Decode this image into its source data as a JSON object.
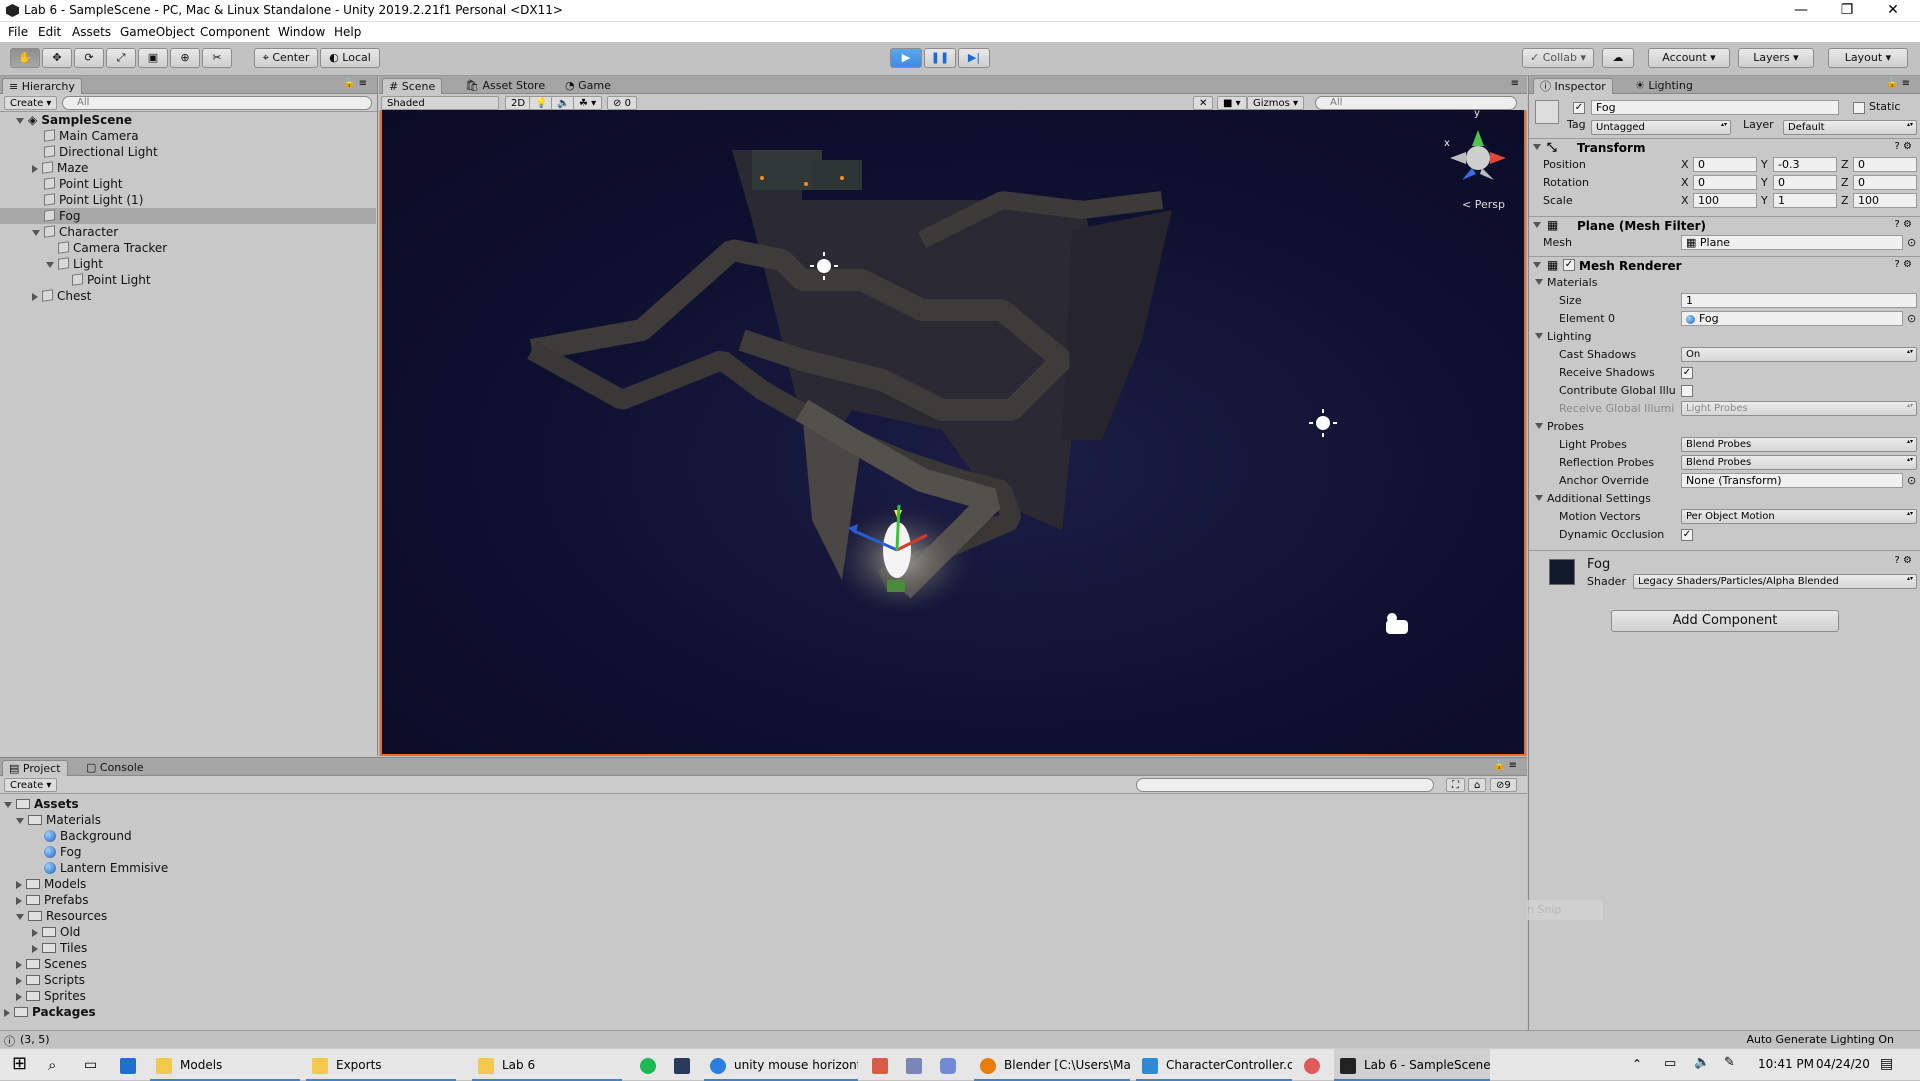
{
  "window": {
    "title": "Lab 6 - SampleScene - PC, Mac & Linux Standalone - Unity 2019.2.21f1 Personal <DX11>",
    "controls": {
      "minimize": "—",
      "maximize": "❐",
      "close": "✕"
    }
  },
  "menu": [
    "File",
    "Edit",
    "Assets",
    "GameObject",
    "Component",
    "Window",
    "Help"
  ],
  "toolbar": {
    "tools": [
      "hand-icon",
      "move-icon",
      "rotate-icon",
      "scale-icon",
      "rect-icon",
      "transform-icon",
      "custom-tool-icon"
    ],
    "pivot": "Center",
    "space": "Local",
    "play_state": "playing",
    "collab": "Collab",
    "account": "Account",
    "layers": "Layers",
    "layout": "Layout"
  },
  "hierarchy": {
    "tab": "Hierarchy",
    "create": "Create",
    "search_placeholder": "All",
    "scene": "SampleScene",
    "items": [
      {
        "label": "Main Camera"
      },
      {
        "label": "Directional Light"
      },
      {
        "label": "Maze"
      },
      {
        "label": "Point Light"
      },
      {
        "label": "Point Light (1)"
      },
      {
        "label": "Fog",
        "selected": true
      },
      {
        "label": "Character"
      },
      {
        "label": "Camera Tracker"
      },
      {
        "label": "Light"
      },
      {
        "label": "Point Light"
      },
      {
        "label": "Chest"
      }
    ]
  },
  "scene_tabs": [
    "Scene",
    "Asset Store",
    "Game"
  ],
  "scene_bar": {
    "shading": "Shaded",
    "mode_2d": "2D",
    "fx_count": "0",
    "gizmos": "Gizmos",
    "search_placeholder": "All",
    "persp_label": "Persp",
    "axis_y": "y",
    "axis_x": "x"
  },
  "inspector": {
    "tabs": [
      "Inspector",
      "Lighting"
    ],
    "object_name": "Fog",
    "static_label": "Static",
    "tag_label": "Tag",
    "tag": "Untagged",
    "layer_label": "Layer",
    "layer": "Default",
    "transform": {
      "title": "Transform",
      "position_label": "Position",
      "rotation_label": "Rotation",
      "scale_label": "Scale",
      "x": "X",
      "y": "Y",
      "z": "Z",
      "position": [
        "0",
        "-0.3",
        "0"
      ],
      "rotation": [
        "0",
        "0",
        "0"
      ],
      "scale": [
        "100",
        "1",
        "100"
      ]
    },
    "mesh_filter": {
      "title": "Plane (Mesh Filter)",
      "mesh_label": "Mesh",
      "mesh": "Plane"
    },
    "mesh_renderer": {
      "title": "Mesh Renderer",
      "materials": "Materials",
      "size_label": "Size",
      "size": "1",
      "element0_label": "Element 0",
      "element0": "Fog",
      "lighting": "Lighting",
      "cast_shadows_label": "Cast Shadows",
      "cast_shadows": "On",
      "receive_shadows_label": "Receive Shadows",
      "contribute_gi_label": "Contribute Global Illu",
      "receive_gi_label": "Receive Global Illumi",
      "receive_gi": "Light Probes",
      "probes": "Probes",
      "light_probes_label": "Light Probes",
      "light_probes": "Blend Probes",
      "reflection_probes_label": "Reflection Probes",
      "reflection_probes": "Blend Probes",
      "anchor_label": "Anchor Override",
      "anchor": "None (Transform)",
      "additional": "Additional Settings",
      "motion_vectors_label": "Motion Vectors",
      "motion_vectors": "Per Object Motion",
      "dynamic_occlusion_label": "Dynamic Occlusion"
    },
    "material": {
      "name": "Fog",
      "shader_label": "Shader",
      "shader": "Legacy Shaders/Particles/Alpha Blended"
    },
    "add_component": "Add Component",
    "faded_text": "Full-screen Snip"
  },
  "project": {
    "tabs": [
      "Project",
      "Console"
    ],
    "create": "Create",
    "hidden_count": "9",
    "tree": [
      {
        "label": "Assets",
        "bold": true
      },
      {
        "label": "Materials"
      },
      {
        "label": "Background"
      },
      {
        "label": "Fog"
      },
      {
        "label": "Lantern Emmisive"
      },
      {
        "label": "Models"
      },
      {
        "label": "Prefabs"
      },
      {
        "label": "Resources"
      },
      {
        "label": "Old"
      },
      {
        "label": "Tiles"
      },
      {
        "label": "Scenes"
      },
      {
        "label": "Scripts"
      },
      {
        "label": "Sprites"
      },
      {
        "label": "Packages",
        "bold": true
      }
    ]
  },
  "status": {
    "message": "(3, 5)",
    "right": "Auto Generate Lighting On"
  },
  "taskbar": {
    "items": [
      "Models",
      "Exports",
      "Lab 6",
      "unity mouse horizont...",
      "Blender [C:\\Users\\Ma...",
      "CharacterController.c...",
      "Lab 6 - SampleScene ..."
    ],
    "time": "10:41 PM",
    "date": "04/24/20"
  },
  "colors": {
    "accent": "#e8702a",
    "play_blue": "#3a8ee6",
    "scene_bg": "#101030"
  }
}
